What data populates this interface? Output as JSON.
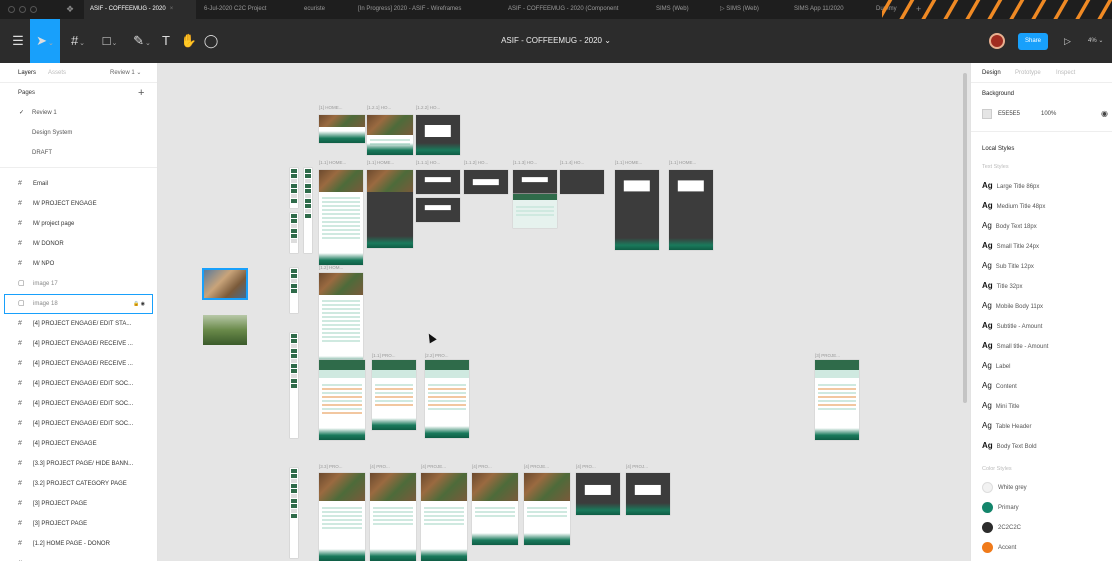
{
  "tabs": [
    {
      "label": "ASIF - COFFEEMUG - 2020",
      "active": true
    },
    {
      "label": "6-Jul-2020 C2C Project",
      "active": false
    },
    {
      "label": "ecuriste",
      "active": false
    },
    {
      "label": "[In Progress] 2020 - ASIF - Wireframes",
      "active": false
    },
    {
      "label": "ASIF - COFFEEMUG - 2020 (Component",
      "active": false
    },
    {
      "label": "SIMS (Web)",
      "active": false
    },
    {
      "label": "▷ SIMS (Web)",
      "active": false
    },
    {
      "label": "SIMS App 11/2020",
      "active": false
    },
    {
      "label": "Dummy",
      "active": false
    }
  ],
  "toolbar": {
    "doc_title": "ASIF - COFFEEMUG - 2020 ⌄",
    "share_label": "Share",
    "zoom": "4% ⌄"
  },
  "left_panel": {
    "tab_layers": "Layers",
    "tab_assets": "Assets",
    "page_select": "Review 1 ⌄",
    "pages_heading": "Pages",
    "pages": [
      "Review 1",
      "Design System",
      "DRAFT"
    ],
    "layers": [
      {
        "label": "Email",
        "icon": "frame-icon"
      },
      {
        "label": "M/ PROJECT ENGAGE",
        "icon": "frame-icon"
      },
      {
        "label": "M/ project page",
        "icon": "frame-icon"
      },
      {
        "label": "M/ DONOR",
        "icon": "frame-icon"
      },
      {
        "label": "M/ NPO",
        "icon": "frame-icon"
      },
      {
        "label": "image 17",
        "icon": "image-icon"
      },
      {
        "label": "image 18",
        "icon": "image-icon",
        "selected": true
      },
      {
        "label": "[4] PROJECT ENGAGE/ EDIT STA...",
        "icon": "frame-icon"
      },
      {
        "label": "[4] PROJECT ENGAGE/ RECEIVE ...",
        "icon": "frame-icon"
      },
      {
        "label": "[4] PROJECT ENGAGE/ RECEIVE ...",
        "icon": "frame-icon"
      },
      {
        "label": "[4] PROJECT ENGAGE/ EDIT SOC...",
        "icon": "frame-icon"
      },
      {
        "label": "[4] PROJECT ENGAGE/ EDIT SOC...",
        "icon": "frame-icon"
      },
      {
        "label": "[4] PROJECT ENGAGE/ EDIT SOC...",
        "icon": "frame-icon"
      },
      {
        "label": "[4] PROJECT ENGAGE",
        "icon": "frame-icon"
      },
      {
        "label": "[3.3] PROJECT PAGE/ HIDE BANN...",
        "icon": "frame-icon"
      },
      {
        "label": "[3.2] PROJECT CATEGORY PAGE",
        "icon": "frame-icon"
      },
      {
        "label": "[3] PROJECT PAGE",
        "icon": "frame-icon"
      },
      {
        "label": "[3] PROJECT PAGE",
        "icon": "frame-icon"
      },
      {
        "label": "[1.2] HOME PAGE - DONOR",
        "icon": "frame-icon"
      },
      {
        "label": "[1.1.2] HOME PAGE - NPO - Ver2 ...",
        "icon": "frame-icon"
      }
    ]
  },
  "canvas": {
    "labels": {
      "r1a": "[1] HOME...",
      "r1b": "[1.2.1] HO...",
      "r1c": "[1.2.2] HO...",
      "r2a": "[1.1] HOME...",
      "r2b": "[1.1] HOME...",
      "r2c": "[1.1.1] HO...",
      "r2d": "[1.1.2] HO...",
      "r2e": "[1.1.3] HO...",
      "r2f": "[1.1.4] HO...",
      "r2g": "[1.1] HOME...",
      "r2h": "[1.1] HOME...",
      "r3a": "[1.2] HOM...",
      "r4a": "[1.1] PRO...",
      "r4b": "[2.2] PRO...",
      "r4c": "[3] PROJE...",
      "r5a": "[3.3] PRO...",
      "r5b": "[4] PRO...",
      "r5c": "[4] PROJE...",
      "r5d": "[4] PRO...",
      "r5e": "[4] PROJE...",
      "r5f": "[4] PRO...",
      "r5g": "[4] PROJ..."
    }
  },
  "right_panel": {
    "tab_design": "Design",
    "tab_prototype": "Prototype",
    "tab_inspect": "Inspect",
    "background_heading": "Background",
    "bg_hex": "E5E5E5",
    "bg_opacity": "100%",
    "local_styles_heading": "Local Styles",
    "text_styles_heading": "Text Styles",
    "ag": "Ag",
    "text_styles": [
      "Large Title 86px",
      "Medium Title 48px",
      "Body Text 18px",
      "Small Title 24px",
      "Sub Title 12px",
      "Title 32px",
      "Mobile Body 11px",
      "Subtitle - Amount",
      "Small title - Amount",
      "Label",
      "Content",
      "Mini Title",
      "Table Header",
      "Body Text Bold"
    ],
    "color_styles_heading": "Color Styles",
    "color_styles": [
      {
        "name": "White grey",
        "color": "#f2f2f2"
      },
      {
        "name": "Primary",
        "color": "#13856b"
      },
      {
        "name": "2C2C2C",
        "color": "#2c2c2c"
      },
      {
        "name": "Accent",
        "color": "#f07a1a"
      }
    ]
  },
  "colors": {
    "brand_green": "#13856b",
    "figma_blue": "#18a0fb",
    "accent": "#f07a1a"
  }
}
